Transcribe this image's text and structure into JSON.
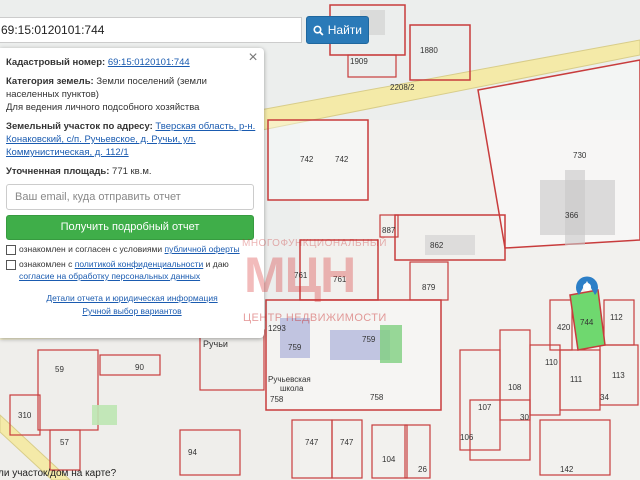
{
  "search": {
    "value": "69:15:0120101:744",
    "button_label": "Найти"
  },
  "panel": {
    "cadastral_label": "Кадастровый номер:",
    "cadastral_value": "69:15:0120101:744",
    "category_label": "Категория земель:",
    "category_value_1": "Земли поселений (земли",
    "category_value_2": "населенных пунктов)",
    "use_value": "Для ведения личного подсобного хозяйства",
    "address_label": "Земельный участок по адресу:",
    "address_1": "Тверская область, р-н.",
    "address_2": "Конаковский, с/п. Ручьевское, д. Ручьи, ул.",
    "address_3": "Коммунистическая, д. 112/1",
    "area_label": "Уточненная площадь:",
    "area_value": "771 кв.м.",
    "email_placeholder": "Ваш email, куда отправить отчет",
    "report_button": "Получить подробный отчет",
    "check1_text": "ознакомлен и согласен с условиями",
    "check1_link": "публичной оферты",
    "check2_text": "ознакомлен с",
    "check2_link1": "политикой конфиденциальности",
    "check2_mid": "и даю",
    "check2_link2": "согласие на обработку персональных данных",
    "details_link": "Детали отчета и юридическая информация",
    "manual_link": "Ручной выбор вариантов"
  },
  "watermark": {
    "top": "МНОГОФУНКЦИОНАЛЬНЫЙ",
    "main": "МЦН",
    "bottom": "ЦЕНТР НЕДВИЖИМОСТИ"
  },
  "map": {
    "labels": {
      "l1880": "1880",
      "l1909": "1909",
      "l2208": "2208/2",
      "l742a": "742",
      "l742b": "742",
      "l730": "730",
      "l366": "366",
      "l887": "887",
      "l862": "862",
      "l879": "879",
      "l761a": "761",
      "l761b": "761",
      "l759a": "759",
      "l759b": "759",
      "l758a": "758",
      "l758b": "758",
      "school1": "Ручьевская",
      "school2": "школа",
      "ruchi": "Ручьи",
      "l90": "90",
      "l59": "59",
      "l310": "310",
      "l57": "57",
      "l94": "94",
      "l747a": "747",
      "l747b": "747",
      "l104": "104",
      "l420": "420",
      "l744": "744",
      "l112": "112",
      "l110": "110",
      "l108": "108",
      "l111": "111",
      "l113": "113",
      "l107": "107",
      "l106": "106",
      "l34": "34",
      "l30": "30",
      "l142": "142",
      "l26": "26",
      "l1293": "1293"
    },
    "colors": {
      "parcel_border": "#c83c3c",
      "road": "#f4eaa8",
      "selected": "#6fd86f",
      "marker": "#2c7fc7",
      "building": "#9fa5d6"
    }
  },
  "footer": {
    "question": "ли участок/дом на карте?"
  }
}
